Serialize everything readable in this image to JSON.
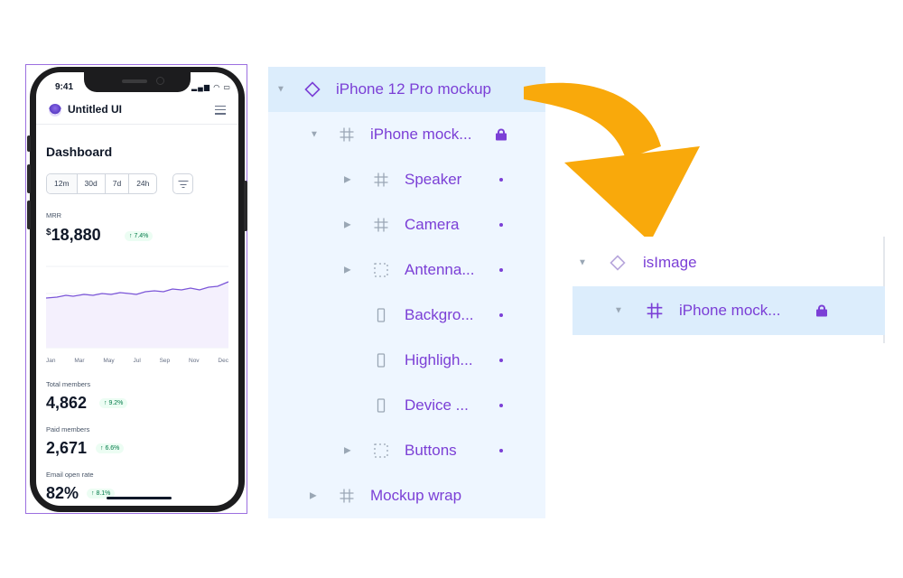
{
  "phone": {
    "status_time": "9:41",
    "status_icons": "▂▄▆ ◠ ▭",
    "app_title": "Untitled UI",
    "dashboard_title": "Dashboard",
    "tabs": [
      "12m",
      "30d",
      "7d",
      "24h"
    ],
    "mrr": {
      "label": "MRR",
      "currency": "$",
      "value": "18,880",
      "change": "↑ 7.4%"
    },
    "chart_months": [
      "Jan",
      "Mar",
      "May",
      "Jul",
      "Sep",
      "Nov",
      "Dec"
    ],
    "total_members": {
      "label": "Total members",
      "value": "4,862",
      "change": "↑ 9.2%"
    },
    "paid_members": {
      "label": "Paid members",
      "value": "2,671",
      "change": "↑ 6.6%"
    },
    "email_open_rate": {
      "label": "Email open rate",
      "value": "82%",
      "change": "↑ 8.1%"
    }
  },
  "layers": [
    {
      "label": "iPhone 12 Pro mockup",
      "icon": "component-icon",
      "caret": "▼",
      "selected": true
    },
    {
      "label": "iPhone mock...",
      "icon": "frame-icon",
      "caret": "▼",
      "locked": true
    },
    {
      "label": "Speaker",
      "icon": "frame-icon",
      "caret": "▶",
      "dot": true
    },
    {
      "label": "Camera",
      "icon": "frame-icon",
      "caret": "▶",
      "dot": true
    },
    {
      "label": "Antenna...",
      "icon": "dashed-frame-icon",
      "caret": "▶",
      "dot": true
    },
    {
      "label": "Backgro...",
      "icon": "rectangle-icon",
      "dot": true
    },
    {
      "label": "Highligh...",
      "icon": "rectangle-icon",
      "dot": true
    },
    {
      "label": "Device ...",
      "icon": "rectangle-icon",
      "dot": true
    },
    {
      "label": "Buttons",
      "icon": "dashed-frame-icon",
      "caret": "▶",
      "dot": true
    },
    {
      "label": "Mockup wrap",
      "icon": "frame-icon",
      "caret": "▶"
    }
  ],
  "result": [
    {
      "label": "isImage",
      "icon": "component-icon",
      "caret": "▼"
    },
    {
      "label": "iPhone mock...",
      "icon": "frame-icon",
      "caret": "▼",
      "locked": true,
      "selected": true
    }
  ],
  "colors": {
    "accent": "#7b3fd6",
    "arrow": "#f9a90b",
    "panel_bg": "#eef6ff",
    "selected_bg": "#dcedfc"
  }
}
